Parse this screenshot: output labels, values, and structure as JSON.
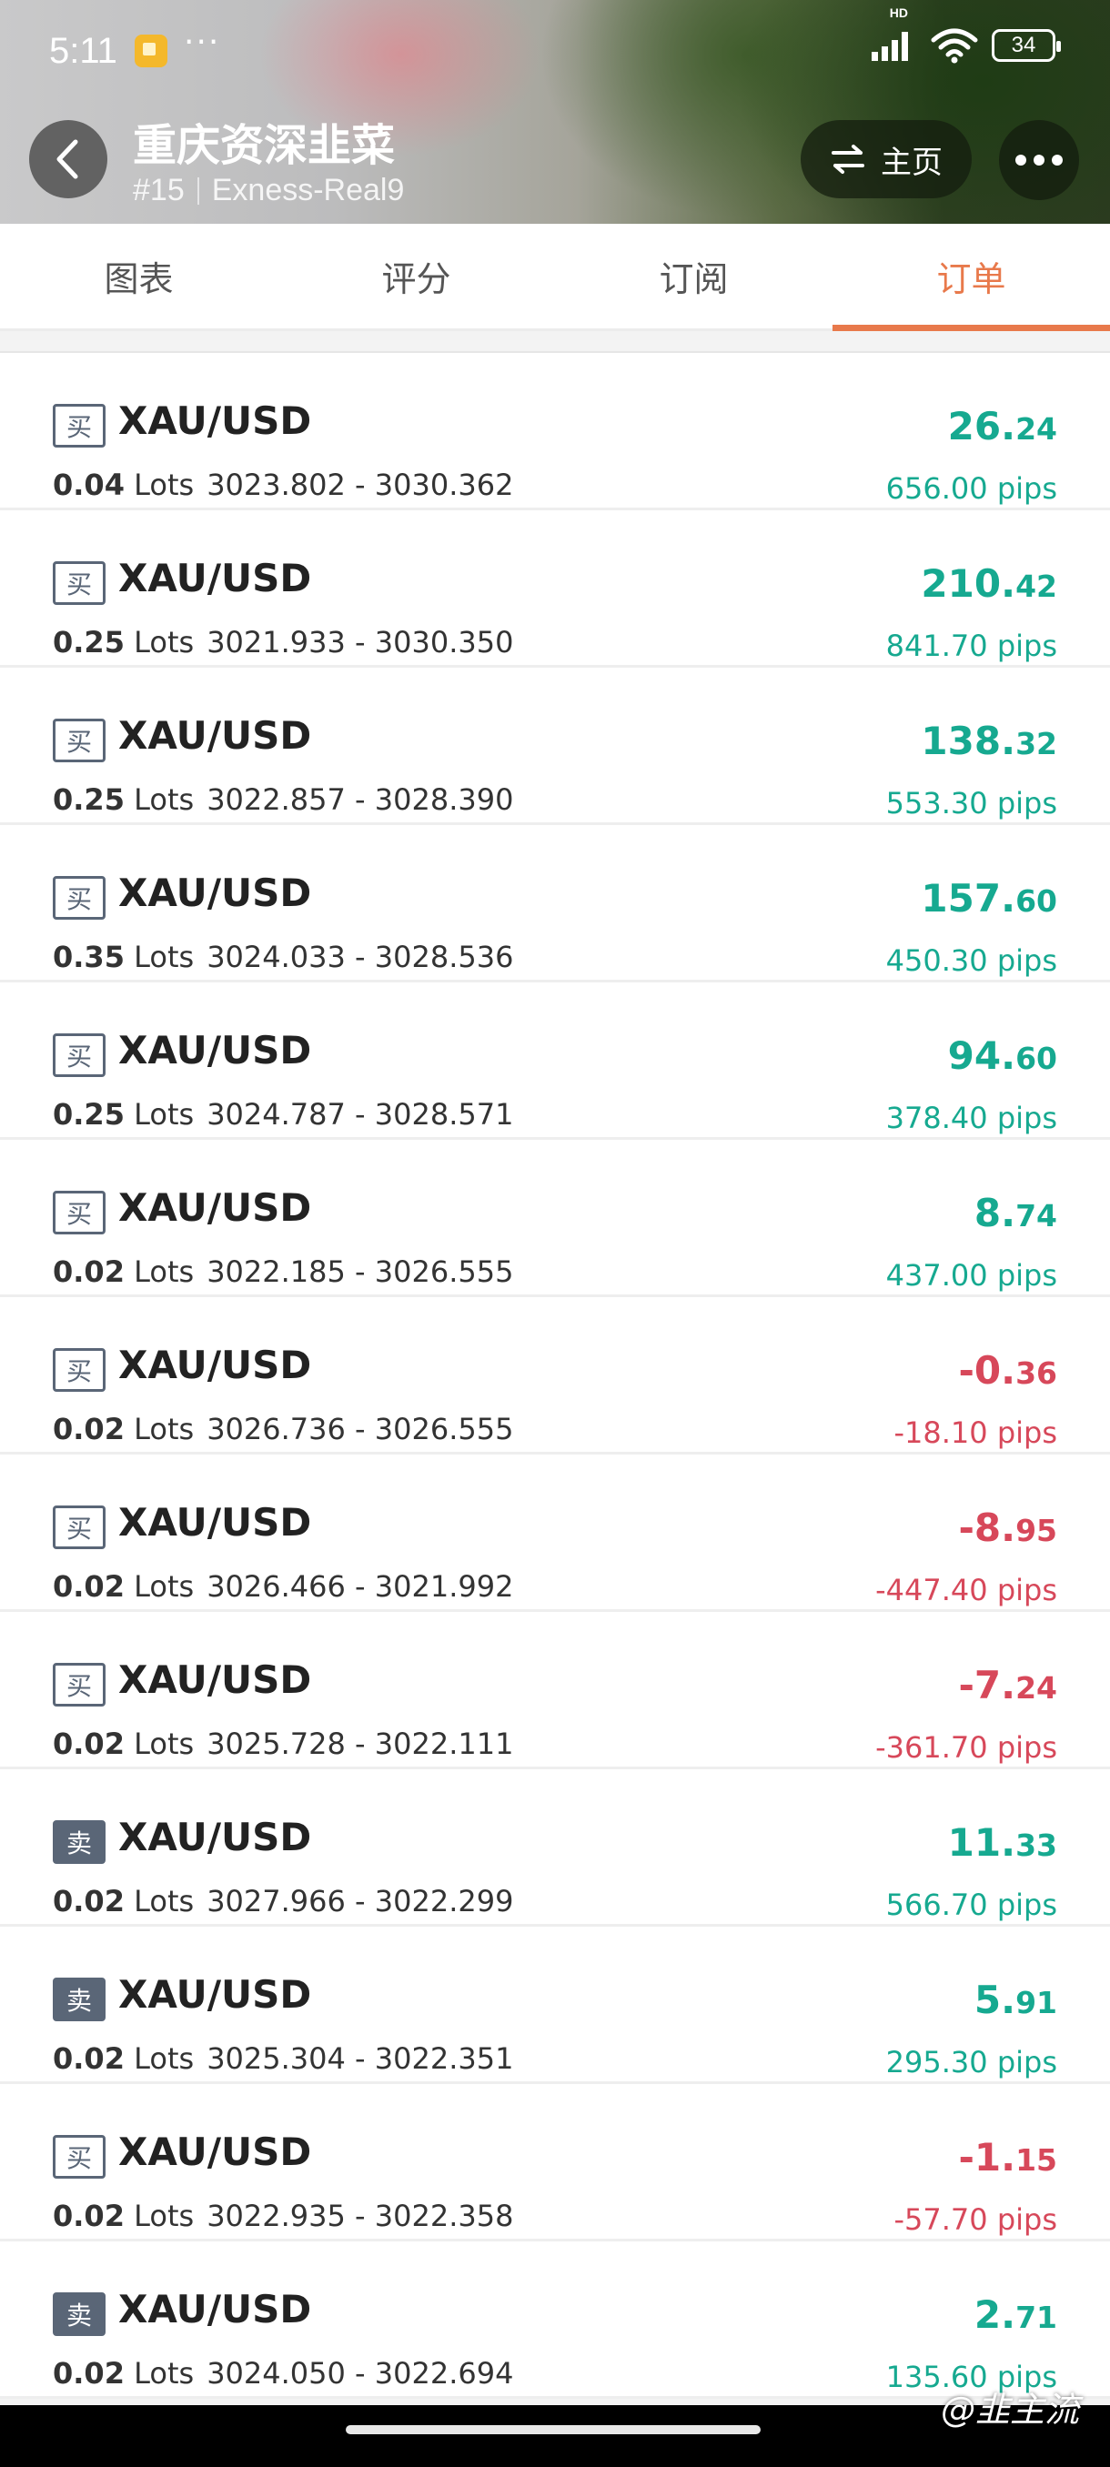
{
  "status_bar": {
    "time": "5:11",
    "dots": "···",
    "network": "HD",
    "battery": "34"
  },
  "header": {
    "title": "重庆资深韭菜",
    "rank": "#15",
    "account": "Exness-Real9",
    "home_label": "主页",
    "home_icon": "swap-arrows-icon",
    "more_icon": "more-dots-icon",
    "back_icon": "back-arrow-icon"
  },
  "tabs": [
    {
      "label": "图表",
      "active": false
    },
    {
      "label": "评分",
      "active": false
    },
    {
      "label": "订阅",
      "active": false
    },
    {
      "label": "订单",
      "active": true
    }
  ],
  "colors": {
    "accent": "#e8794b",
    "profit": "#16a990",
    "loss": "#d7485a",
    "side_badge": "#5a6677"
  },
  "lots_unit": "Lots",
  "pips_unit": "pips",
  "orders": [
    {
      "side": "买",
      "side_type": "buy",
      "symbol": "XAU/USD",
      "lots": "0.04",
      "prices": "3023.802 - 3030.362",
      "pnl_int": "26.",
      "pnl_dec": "24",
      "pips": "656.00",
      "sign": "pos"
    },
    {
      "side": "买",
      "side_type": "buy",
      "symbol": "XAU/USD",
      "lots": "0.25",
      "prices": "3021.933 - 3030.350",
      "pnl_int": "210.",
      "pnl_dec": "42",
      "pips": "841.70",
      "sign": "pos"
    },
    {
      "side": "买",
      "side_type": "buy",
      "symbol": "XAU/USD",
      "lots": "0.25",
      "prices": "3022.857 - 3028.390",
      "pnl_int": "138.",
      "pnl_dec": "32",
      "pips": "553.30",
      "sign": "pos"
    },
    {
      "side": "买",
      "side_type": "buy",
      "symbol": "XAU/USD",
      "lots": "0.35",
      "prices": "3024.033 - 3028.536",
      "pnl_int": "157.",
      "pnl_dec": "60",
      "pips": "450.30",
      "sign": "pos"
    },
    {
      "side": "买",
      "side_type": "buy",
      "symbol": "XAU/USD",
      "lots": "0.25",
      "prices": "3024.787 - 3028.571",
      "pnl_int": "94.",
      "pnl_dec": "60",
      "pips": "378.40",
      "sign": "pos"
    },
    {
      "side": "买",
      "side_type": "buy",
      "symbol": "XAU/USD",
      "lots": "0.02",
      "prices": "3022.185 - 3026.555",
      "pnl_int": "8.",
      "pnl_dec": "74",
      "pips": "437.00",
      "sign": "pos"
    },
    {
      "side": "买",
      "side_type": "buy",
      "symbol": "XAU/USD",
      "lots": "0.02",
      "prices": "3026.736 - 3026.555",
      "pnl_int": "-0.",
      "pnl_dec": "36",
      "pips": "-18.10",
      "sign": "neg"
    },
    {
      "side": "买",
      "side_type": "buy",
      "symbol": "XAU/USD",
      "lots": "0.02",
      "prices": "3026.466 - 3021.992",
      "pnl_int": "-8.",
      "pnl_dec": "95",
      "pips": "-447.40",
      "sign": "neg"
    },
    {
      "side": "买",
      "side_type": "buy",
      "symbol": "XAU/USD",
      "lots": "0.02",
      "prices": "3025.728 - 3022.111",
      "pnl_int": "-7.",
      "pnl_dec": "24",
      "pips": "-361.70",
      "sign": "neg"
    },
    {
      "side": "卖",
      "side_type": "sell",
      "symbol": "XAU/USD",
      "lots": "0.02",
      "prices": "3027.966 - 3022.299",
      "pnl_int": "11.",
      "pnl_dec": "33",
      "pips": "566.70",
      "sign": "pos"
    },
    {
      "side": "卖",
      "side_type": "sell",
      "symbol": "XAU/USD",
      "lots": "0.02",
      "prices": "3025.304 - 3022.351",
      "pnl_int": "5.",
      "pnl_dec": "91",
      "pips": "295.30",
      "sign": "pos"
    },
    {
      "side": "买",
      "side_type": "buy",
      "symbol": "XAU/USD",
      "lots": "0.02",
      "prices": "3022.935 - 3022.358",
      "pnl_int": "-1.",
      "pnl_dec": "15",
      "pips": "-57.70",
      "sign": "neg"
    },
    {
      "side": "卖",
      "side_type": "sell",
      "symbol": "XAU/USD",
      "lots": "0.02",
      "prices": "3024.050 - 3022.694",
      "pnl_int": "2.",
      "pnl_dec": "71",
      "pips": "135.60",
      "sign": "pos"
    }
  ],
  "watermark": "@韭主流"
}
